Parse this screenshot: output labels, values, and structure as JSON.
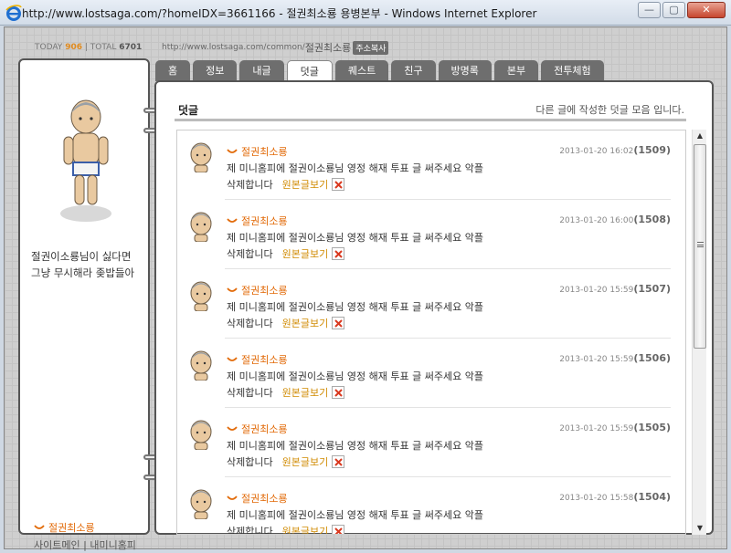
{
  "window": {
    "title": "http://www.lostsaga.com/?homeIDX=3661166 - 절권최소룡 용병본부 - Windows Internet Explorer",
    "min_glyph": "—",
    "max_glyph": "▢",
    "close_glyph": "✕"
  },
  "header": {
    "today_label": "TODAY",
    "today_count": "906",
    "sep": "|",
    "total_label": "TOTAL",
    "total_count": "6701",
    "url": "http://www.lostsaga.com/common/",
    "url_name": "절권최소룡",
    "copy_button": "주소복사"
  },
  "profile": {
    "message_line1": "절권이소룡님이 싫다면",
    "message_line2": "그냥 무시해라 좆밥들아",
    "name": "절권최소룡",
    "link_main": "사이트메인",
    "link_sep": "|",
    "link_home": "내미니홈피"
  },
  "tabs": [
    {
      "label": "홈"
    },
    {
      "label": "정보"
    },
    {
      "label": "내글"
    },
    {
      "label": "덧글"
    },
    {
      "label": "퀘스트"
    },
    {
      "label": "친구"
    },
    {
      "label": "방명록"
    },
    {
      "label": "본부"
    },
    {
      "label": "전투체험"
    }
  ],
  "section": {
    "title": "덧글",
    "description": "다른 글에 작성한 덧글 모음 입니다."
  },
  "comments": [
    {
      "author": "절권최소룡",
      "date": "2013-01-20 16:02",
      "number": "(1509)",
      "text": "제 미니홈피에 절권이소룡님 영정 해재 투표 글 써주세요 악플",
      "text2": "삭제합니다",
      "link": "원본글보기"
    },
    {
      "author": "절권최소룡",
      "date": "2013-01-20 16:00",
      "number": "(1508)",
      "text": "제 미니홈피에 절권이소룡님 영정 해재 투표 글 써주세요 악플",
      "text2": "삭제합니다",
      "link": "원본글보기"
    },
    {
      "author": "절권최소룡",
      "date": "2013-01-20 15:59",
      "number": "(1507)",
      "text": "제 미니홈피에 절권이소룡님 영정 해재 투표 글 써주세요 악플",
      "text2": "삭제합니다",
      "link": "원본글보기"
    },
    {
      "author": "절권최소룡",
      "date": "2013-01-20 15:59",
      "number": "(1506)",
      "text": "제 미니홈피에 절권이소룡님 영정 해재 투표 글 써주세요 악플",
      "text2": "삭제합니다",
      "link": "원본글보기"
    },
    {
      "author": "절권최소룡",
      "date": "2013-01-20 15:59",
      "number": "(1505)",
      "text": "제 미니홈피에 절권이소룡님 영정 해재 투표 글 써주세요 악플",
      "text2": "삭제합니다",
      "link": "원본글보기"
    },
    {
      "author": "절권최소룡",
      "date": "2013-01-20 15:58",
      "number": "(1504)",
      "text": "제 미니홈피에 절권이소룡님 영정 해재 투표 글 써주세요 악플",
      "text2": "삭제합니다",
      "link": "원본글보기"
    }
  ],
  "colors": {
    "accent_orange": "#e26b0a",
    "link_gold": "#d08a00",
    "tab_dark": "#6e6e6e",
    "delete_red": "#d9381e"
  },
  "icons": {
    "browser": "ie-logo-icon",
    "delete": "close-x-icon",
    "name_mark": "orange-smile-mark-icon"
  }
}
